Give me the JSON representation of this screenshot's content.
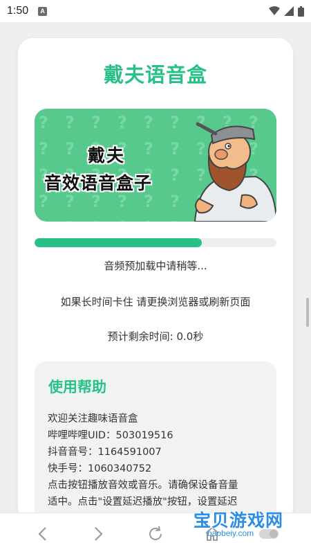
{
  "status_bar": {
    "time": "1:50",
    "notification_letter": "A"
  },
  "app": {
    "title": "戴夫语音盒",
    "banner": {
      "line1": "戴夫",
      "line2": "音效语音盒子"
    }
  },
  "loading": {
    "progress": 0.69,
    "status_text": "音频预加载中请稍等...",
    "hint_text": "如果长时间卡住 请更换浏览器或刷新页面",
    "remaining_text": "预计剩余时间: 0.0秒"
  },
  "help": {
    "title": "使用帮助",
    "lines": [
      "欢迎关注趣味语音盒",
      "哔哩哔哩UID：503019516",
      "抖音音号：1164591007",
      "快手号：1060340752",
      "点击按钮播放音效或音乐。请确保设备音量",
      "适中。点击\"设置延迟播放\"按钮，设置延迟"
    ]
  },
  "watermark": {
    "main": "宝贝游戏网",
    "sub": "baobeiy.com"
  },
  "colors": {
    "accent": "#27c187",
    "watermark": "#2b8de6"
  },
  "icons": [
    "back-icon",
    "forward-icon",
    "refresh-icon",
    "home-icon",
    "wifi-icon",
    "signal-icon",
    "battery-icon"
  ]
}
